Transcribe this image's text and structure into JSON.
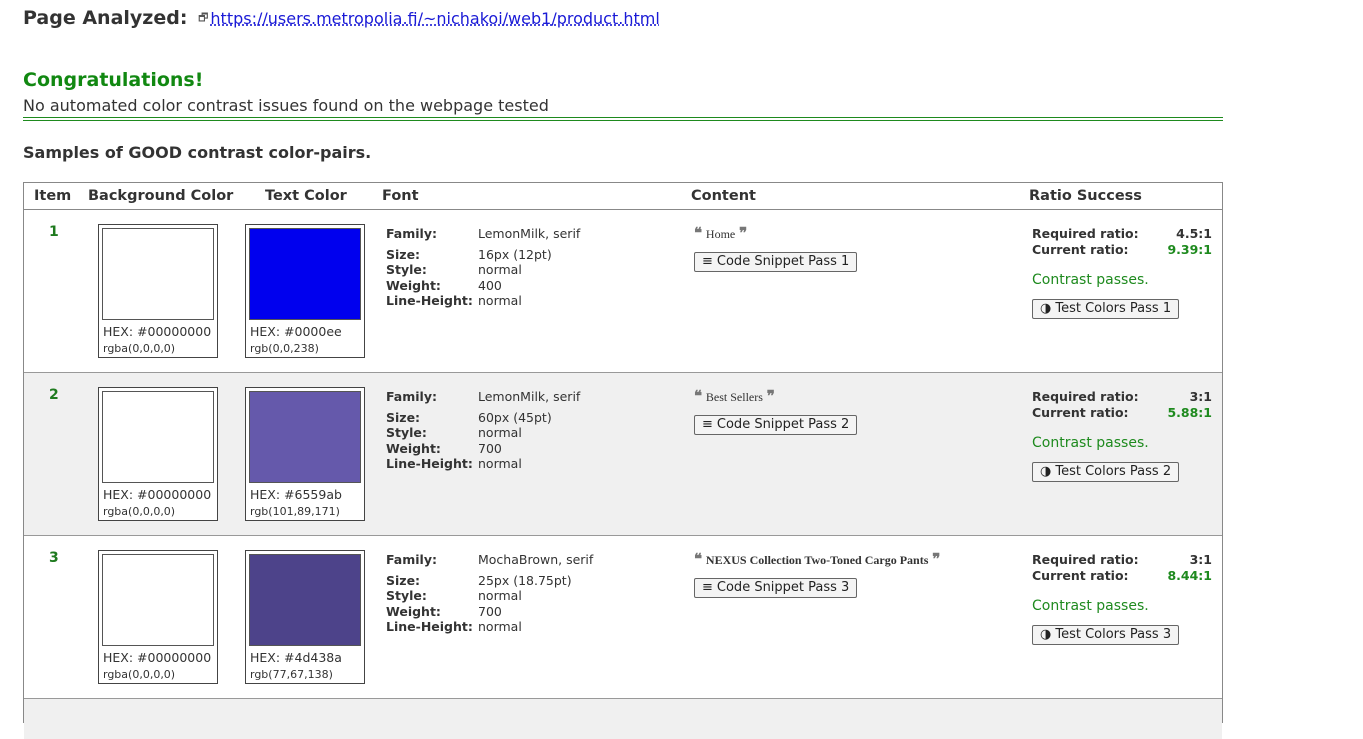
{
  "header": {
    "label": "Page Analyzed:",
    "url": "https://users.metropolia.fi/~nichakoi/web1/product.html"
  },
  "result": {
    "title": "Congratulations!",
    "message": "No automated color contrast issues found on the webpage tested"
  },
  "samples_title": "Samples of GOOD contrast color-pairs.",
  "columns": [
    "Item",
    "Background Color",
    "Text Color",
    "Font",
    "Content",
    "Ratio Success"
  ],
  "font_labels": {
    "family": "Family:",
    "size": "Size:",
    "style": "Style:",
    "weight": "Weight:",
    "line_height": "Line-Height:"
  },
  "ratio_labels": {
    "required": "Required ratio:",
    "current": "Current ratio:"
  },
  "colors": {
    "accent_green": "#1e8a1e",
    "link_blue": "#1a1ad6"
  },
  "rows": [
    {
      "item": "1",
      "bg_hex": "HEX: #00000000",
      "bg_rgb": "rgba(0,0,0,0)",
      "bg_swatch": "#ffffff",
      "txt_hex": "HEX: #0000ee",
      "txt_rgb": "rgb(0,0,238)",
      "txt_swatch": "#0000ee",
      "family": "LemonMilk, serif",
      "size": "16px (12pt)",
      "style": "normal",
      "weight": "400",
      "line_height": "normal",
      "content": "Home",
      "snippet": "Code Snippet Pass 1",
      "required": "4.5:1",
      "current": "9.39:1",
      "status": "Contrast passes.",
      "test": "Test Colors Pass 1"
    },
    {
      "item": "2",
      "bg_hex": "HEX: #00000000",
      "bg_rgb": "rgba(0,0,0,0)",
      "bg_swatch": "#ffffff",
      "txt_hex": "HEX: #6559ab",
      "txt_rgb": "rgb(101,89,171)",
      "txt_swatch": "#6559ab",
      "family": "LemonMilk, serif",
      "size": "60px (45pt)",
      "style": "normal",
      "weight": "700",
      "line_height": "normal",
      "content": "Best Sellers",
      "snippet": "Code Snippet Pass 2",
      "required": "3:1",
      "current": "5.88:1",
      "status": "Contrast passes.",
      "test": "Test Colors Pass 2"
    },
    {
      "item": "3",
      "bg_hex": "HEX: #00000000",
      "bg_rgb": "rgba(0,0,0,0)",
      "bg_swatch": "#ffffff",
      "txt_hex": "HEX: #4d438a",
      "txt_rgb": "rgb(77,67,138)",
      "txt_swatch": "#4d438a",
      "family": "MochaBrown, serif",
      "size": "25px (18.75pt)",
      "style": "normal",
      "weight": "700",
      "line_height": "normal",
      "content": "NEXUS Collection Two-Toned Cargo Pants",
      "snippet": "Code Snippet Pass 3",
      "required": "3:1",
      "current": "8.44:1",
      "status": "Contrast passes.",
      "test": "Test Colors Pass 3"
    }
  ]
}
